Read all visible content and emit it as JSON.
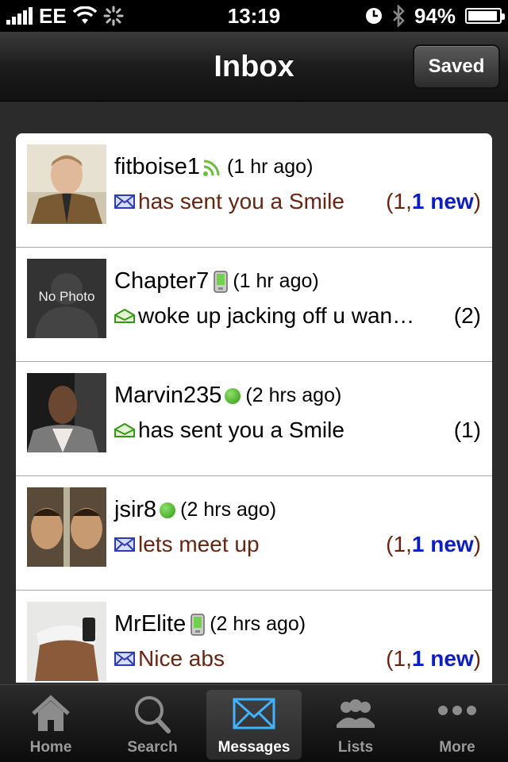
{
  "status_bar": {
    "carrier": "EE",
    "time": "13:19",
    "battery": "94%",
    "battery_level": 0.94
  },
  "nav": {
    "title": "Inbox",
    "saved_label": "Saved"
  },
  "messages": [
    {
      "name": "fitboise1",
      "presence": "feed-icon",
      "ago": "(1 hr ago)",
      "envelope": "unread-envelope-icon",
      "text": "has sent you a Smile",
      "count_prefix": "(1,",
      "count_new": "1 new",
      "count_suffix": ")",
      "unread": true
    },
    {
      "name": "Chapter7",
      "presence": "phone-icon",
      "ago": "(1 hr ago)",
      "envelope": "read-envelope-icon",
      "avatar_label": "No Photo",
      "text": "woke up jacking off u wan…",
      "count_prefix": "(2)",
      "count_new": "",
      "count_suffix": "",
      "unread": false
    },
    {
      "name": "Marvin235",
      "presence": "online-dot",
      "ago": "(2 hrs ago)",
      "envelope": "read-envelope-icon",
      "text": "has sent you a Smile",
      "count_prefix": "(1)",
      "count_new": "",
      "count_suffix": "",
      "unread": false
    },
    {
      "name": "jsir8",
      "presence": "online-dot",
      "ago": "(2 hrs ago)",
      "envelope": "unread-envelope-icon",
      "text": "lets meet up",
      "count_prefix": "(1,",
      "count_new": "1 new",
      "count_suffix": ")",
      "unread": true
    },
    {
      "name": "MrElite",
      "presence": "phone-icon",
      "ago": "(2 hrs ago)",
      "envelope": "unread-envelope-icon",
      "text": "Nice abs",
      "count_prefix": "(1,",
      "count_new": "1 new",
      "count_suffix": ")",
      "unread": true
    }
  ],
  "tabs": [
    {
      "label": "Home",
      "icon": "home-icon",
      "active": false
    },
    {
      "label": "Search",
      "icon": "magnifier-icon",
      "active": false
    },
    {
      "label": "Messages",
      "icon": "envelope-icon",
      "active": true
    },
    {
      "label": "Lists",
      "icon": "people-icon",
      "active": false
    },
    {
      "label": "More",
      "icon": "more-dots-icon",
      "active": false
    }
  ],
  "colors": {
    "unread_text": "#6b2410",
    "new_count": "#0b1ccf",
    "divider": "#c9a94f"
  }
}
